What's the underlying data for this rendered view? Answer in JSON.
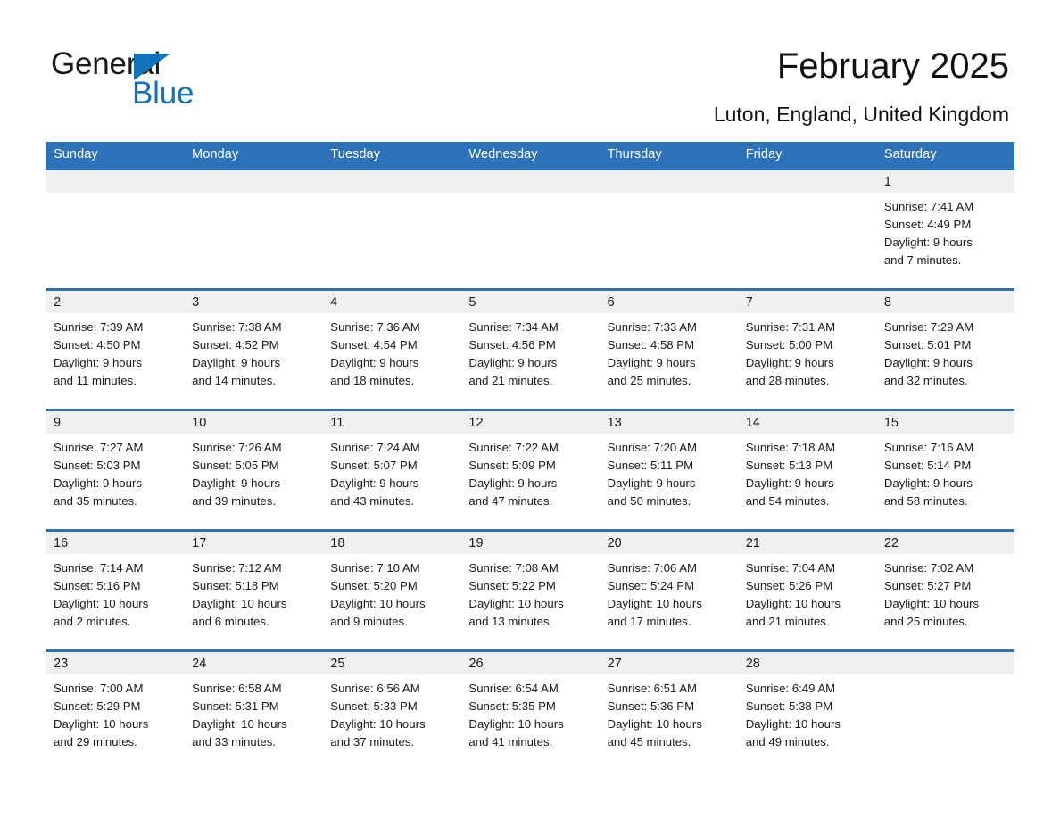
{
  "brand": {
    "name_part1": "General",
    "name_part2": "Blue",
    "logo_triangle_color": "#1272bc",
    "accent_color": "#2d72b8"
  },
  "header": {
    "title": "February 2025",
    "subtitle": "Luton, England, United Kingdom"
  },
  "calendar": {
    "weekday_headers": [
      "Sunday",
      "Monday",
      "Tuesday",
      "Wednesday",
      "Thursday",
      "Friday",
      "Saturday"
    ],
    "weeks": [
      [
        {
          "day": "",
          "sunrise": "",
          "sunset": "",
          "daylight1": "",
          "daylight2": ""
        },
        {
          "day": "",
          "sunrise": "",
          "sunset": "",
          "daylight1": "",
          "daylight2": ""
        },
        {
          "day": "",
          "sunrise": "",
          "sunset": "",
          "daylight1": "",
          "daylight2": ""
        },
        {
          "day": "",
          "sunrise": "",
          "sunset": "",
          "daylight1": "",
          "daylight2": ""
        },
        {
          "day": "",
          "sunrise": "",
          "sunset": "",
          "daylight1": "",
          "daylight2": ""
        },
        {
          "day": "",
          "sunrise": "",
          "sunset": "",
          "daylight1": "",
          "daylight2": ""
        },
        {
          "day": "1",
          "sunrise": "Sunrise: 7:41 AM",
          "sunset": "Sunset: 4:49 PM",
          "daylight1": "Daylight: 9 hours",
          "daylight2": "and 7 minutes."
        }
      ],
      [
        {
          "day": "2",
          "sunrise": "Sunrise: 7:39 AM",
          "sunset": "Sunset: 4:50 PM",
          "daylight1": "Daylight: 9 hours",
          "daylight2": "and 11 minutes."
        },
        {
          "day": "3",
          "sunrise": "Sunrise: 7:38 AM",
          "sunset": "Sunset: 4:52 PM",
          "daylight1": "Daylight: 9 hours",
          "daylight2": "and 14 minutes."
        },
        {
          "day": "4",
          "sunrise": "Sunrise: 7:36 AM",
          "sunset": "Sunset: 4:54 PM",
          "daylight1": "Daylight: 9 hours",
          "daylight2": "and 18 minutes."
        },
        {
          "day": "5",
          "sunrise": "Sunrise: 7:34 AM",
          "sunset": "Sunset: 4:56 PM",
          "daylight1": "Daylight: 9 hours",
          "daylight2": "and 21 minutes."
        },
        {
          "day": "6",
          "sunrise": "Sunrise: 7:33 AM",
          "sunset": "Sunset: 4:58 PM",
          "daylight1": "Daylight: 9 hours",
          "daylight2": "and 25 minutes."
        },
        {
          "day": "7",
          "sunrise": "Sunrise: 7:31 AM",
          "sunset": "Sunset: 5:00 PM",
          "daylight1": "Daylight: 9 hours",
          "daylight2": "and 28 minutes."
        },
        {
          "day": "8",
          "sunrise": "Sunrise: 7:29 AM",
          "sunset": "Sunset: 5:01 PM",
          "daylight1": "Daylight: 9 hours",
          "daylight2": "and 32 minutes."
        }
      ],
      [
        {
          "day": "9",
          "sunrise": "Sunrise: 7:27 AM",
          "sunset": "Sunset: 5:03 PM",
          "daylight1": "Daylight: 9 hours",
          "daylight2": "and 35 minutes."
        },
        {
          "day": "10",
          "sunrise": "Sunrise: 7:26 AM",
          "sunset": "Sunset: 5:05 PM",
          "daylight1": "Daylight: 9 hours",
          "daylight2": "and 39 minutes."
        },
        {
          "day": "11",
          "sunrise": "Sunrise: 7:24 AM",
          "sunset": "Sunset: 5:07 PM",
          "daylight1": "Daylight: 9 hours",
          "daylight2": "and 43 minutes."
        },
        {
          "day": "12",
          "sunrise": "Sunrise: 7:22 AM",
          "sunset": "Sunset: 5:09 PM",
          "daylight1": "Daylight: 9 hours",
          "daylight2": "and 47 minutes."
        },
        {
          "day": "13",
          "sunrise": "Sunrise: 7:20 AM",
          "sunset": "Sunset: 5:11 PM",
          "daylight1": "Daylight: 9 hours",
          "daylight2": "and 50 minutes."
        },
        {
          "day": "14",
          "sunrise": "Sunrise: 7:18 AM",
          "sunset": "Sunset: 5:13 PM",
          "daylight1": "Daylight: 9 hours",
          "daylight2": "and 54 minutes."
        },
        {
          "day": "15",
          "sunrise": "Sunrise: 7:16 AM",
          "sunset": "Sunset: 5:14 PM",
          "daylight1": "Daylight: 9 hours",
          "daylight2": "and 58 minutes."
        }
      ],
      [
        {
          "day": "16",
          "sunrise": "Sunrise: 7:14 AM",
          "sunset": "Sunset: 5:16 PM",
          "daylight1": "Daylight: 10 hours",
          "daylight2": "and 2 minutes."
        },
        {
          "day": "17",
          "sunrise": "Sunrise: 7:12 AM",
          "sunset": "Sunset: 5:18 PM",
          "daylight1": "Daylight: 10 hours",
          "daylight2": "and 6 minutes."
        },
        {
          "day": "18",
          "sunrise": "Sunrise: 7:10 AM",
          "sunset": "Sunset: 5:20 PM",
          "daylight1": "Daylight: 10 hours",
          "daylight2": "and 9 minutes."
        },
        {
          "day": "19",
          "sunrise": "Sunrise: 7:08 AM",
          "sunset": "Sunset: 5:22 PM",
          "daylight1": "Daylight: 10 hours",
          "daylight2": "and 13 minutes."
        },
        {
          "day": "20",
          "sunrise": "Sunrise: 7:06 AM",
          "sunset": "Sunset: 5:24 PM",
          "daylight1": "Daylight: 10 hours",
          "daylight2": "and 17 minutes."
        },
        {
          "day": "21",
          "sunrise": "Sunrise: 7:04 AM",
          "sunset": "Sunset: 5:26 PM",
          "daylight1": "Daylight: 10 hours",
          "daylight2": "and 21 minutes."
        },
        {
          "day": "22",
          "sunrise": "Sunrise: 7:02 AM",
          "sunset": "Sunset: 5:27 PM",
          "daylight1": "Daylight: 10 hours",
          "daylight2": "and 25 minutes."
        }
      ],
      [
        {
          "day": "23",
          "sunrise": "Sunrise: 7:00 AM",
          "sunset": "Sunset: 5:29 PM",
          "daylight1": "Daylight: 10 hours",
          "daylight2": "and 29 minutes."
        },
        {
          "day": "24",
          "sunrise": "Sunrise: 6:58 AM",
          "sunset": "Sunset: 5:31 PM",
          "daylight1": "Daylight: 10 hours",
          "daylight2": "and 33 minutes."
        },
        {
          "day": "25",
          "sunrise": "Sunrise: 6:56 AM",
          "sunset": "Sunset: 5:33 PM",
          "daylight1": "Daylight: 10 hours",
          "daylight2": "and 37 minutes."
        },
        {
          "day": "26",
          "sunrise": "Sunrise: 6:54 AM",
          "sunset": "Sunset: 5:35 PM",
          "daylight1": "Daylight: 10 hours",
          "daylight2": "and 41 minutes."
        },
        {
          "day": "27",
          "sunrise": "Sunrise: 6:51 AM",
          "sunset": "Sunset: 5:36 PM",
          "daylight1": "Daylight: 10 hours",
          "daylight2": "and 45 minutes."
        },
        {
          "day": "28",
          "sunrise": "Sunrise: 6:49 AM",
          "sunset": "Sunset: 5:38 PM",
          "daylight1": "Daylight: 10 hours",
          "daylight2": "and 49 minutes."
        },
        {
          "day": "",
          "sunrise": "",
          "sunset": "",
          "daylight1": "",
          "daylight2": ""
        }
      ]
    ]
  }
}
